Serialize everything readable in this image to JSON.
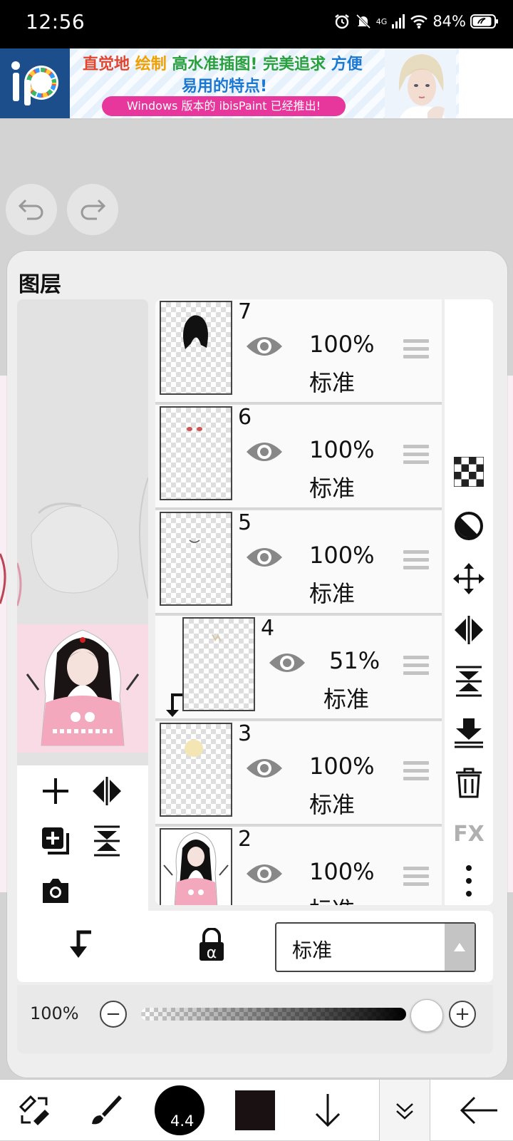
{
  "status_bar": {
    "time": "12:56",
    "network": "4G",
    "battery": "84%"
  },
  "ad": {
    "line1_parts": [
      "直觉地",
      "绘制",
      "高水准插图!",
      "完美追求",
      "方便"
    ],
    "line2": "易用的特点!",
    "pill": "Windows 版本的 ibisPaint 已经推出!"
  },
  "panel": {
    "title": "图层"
  },
  "layers": [
    {
      "number": "7",
      "opacity": "100%",
      "blend": "标准",
      "clipped": false
    },
    {
      "number": "6",
      "opacity": "100%",
      "blend": "标准",
      "clipped": false
    },
    {
      "number": "5",
      "opacity": "100%",
      "blend": "标准",
      "clipped": false
    },
    {
      "number": "4",
      "opacity": "51%",
      "blend": "标准",
      "clipped": true
    },
    {
      "number": "3",
      "opacity": "100%",
      "blend": "标准",
      "clipped": false
    },
    {
      "number": "2",
      "opacity": "100%",
      "blend": "标准",
      "clipped": false
    }
  ],
  "right_tools": {
    "fx_label": "FX"
  },
  "blend_bar": {
    "selected_mode": "标准"
  },
  "opacity_bar": {
    "label": "100%",
    "minus": "−",
    "plus": "+",
    "value": 1.0
  },
  "bottom_toolbar": {
    "brush_size": "4.4",
    "color": "#1a1212"
  },
  "colors": {
    "panel_bg": "#eeeeef",
    "ad_pill": "#e8379c",
    "ad_logo_bg": "#1b4e8a"
  }
}
